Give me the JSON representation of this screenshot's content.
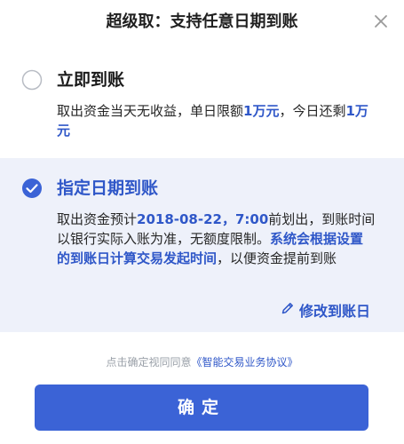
{
  "header": {
    "title": "超级取：支持任意日期到账",
    "close_icon": "close-icon"
  },
  "options": [
    {
      "id": "immediate",
      "title": "立即到账",
      "selected": false,
      "desc_parts": [
        {
          "text": "取出资金当天无收益，单日限额",
          "highlight": false
        },
        {
          "text": "1万元",
          "highlight": true
        },
        {
          "text": "，今日还剩",
          "highlight": false
        },
        {
          "text": "1万元",
          "highlight": true
        }
      ]
    },
    {
      "id": "scheduled",
      "title": "指定日期到账",
      "selected": true,
      "desc_parts": [
        {
          "text": "取出资金预计",
          "highlight": false
        },
        {
          "text": "2018-08-22，7:00",
          "highlight": true
        },
        {
          "text": "前划出，到账时间以银行实际入账为准，无额度限制。",
          "highlight": false
        },
        {
          "text": "系统会根据设置的到账日计算交易发起时间",
          "highlight": true
        },
        {
          "text": "，以便资金提前到账",
          "highlight": false
        }
      ],
      "modify_label": "修改到账日",
      "modify_icon": "pencil-icon"
    }
  ],
  "agreement": {
    "prefix": "点击确定视同同意",
    "link": "《智能交易业务协议》"
  },
  "confirm_label": "确定",
  "colors": {
    "accent": "#2f57c8",
    "button": "#3b63d6",
    "selected_bg": "#eef1fa",
    "muted": "#9aa0a8"
  }
}
